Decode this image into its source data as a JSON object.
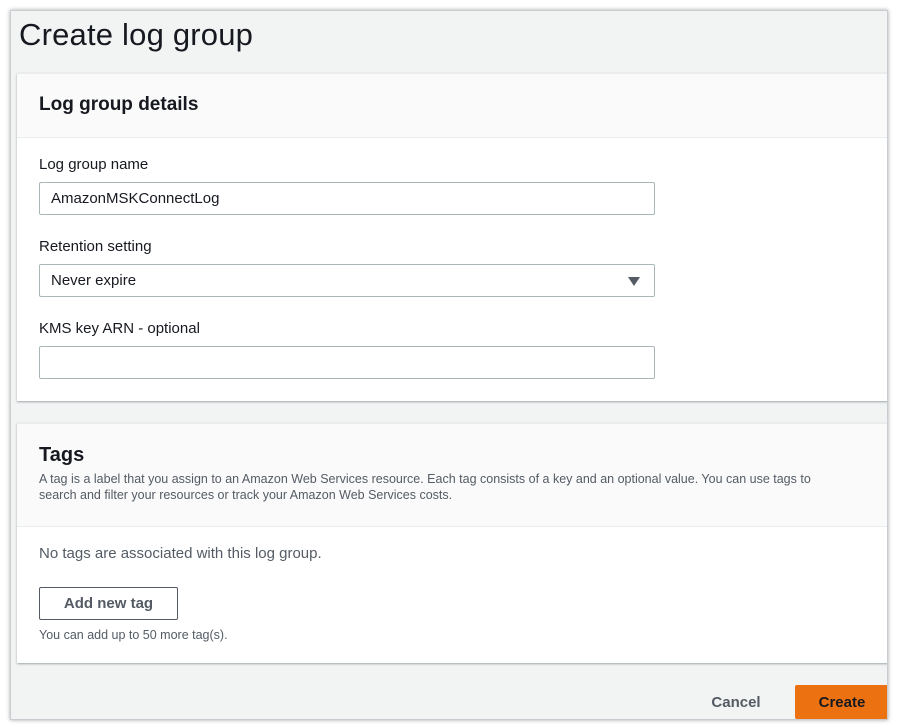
{
  "page": {
    "title": "Create log group"
  },
  "details": {
    "heading": "Log group details",
    "name_label": "Log group name",
    "name_value": "AmazonMSKConnectLog",
    "retention_label": "Retention setting",
    "retention_value": "Never expire",
    "kms_label": "KMS key ARN - optional",
    "kms_value": ""
  },
  "tags": {
    "heading": "Tags",
    "description_line1": "A tag is a label that you assign to an Amazon Web Services resource. Each tag consists of a key and an optional value. You can use tags to",
    "description_line2": "search and filter your resources or track your Amazon Web Services costs.",
    "empty_text": "No tags are associated with this log group.",
    "add_button": "Add new tag",
    "limit_text": "You can add up to 50 more tag(s)."
  },
  "footer": {
    "cancel_label": "Cancel",
    "create_label": "Create"
  },
  "colors": {
    "primary": "#ec7211",
    "border": "#aab7b8",
    "text": "#16191f",
    "muted": "#545b64"
  },
  "icons": {
    "dropdown": "caret-down-icon"
  }
}
